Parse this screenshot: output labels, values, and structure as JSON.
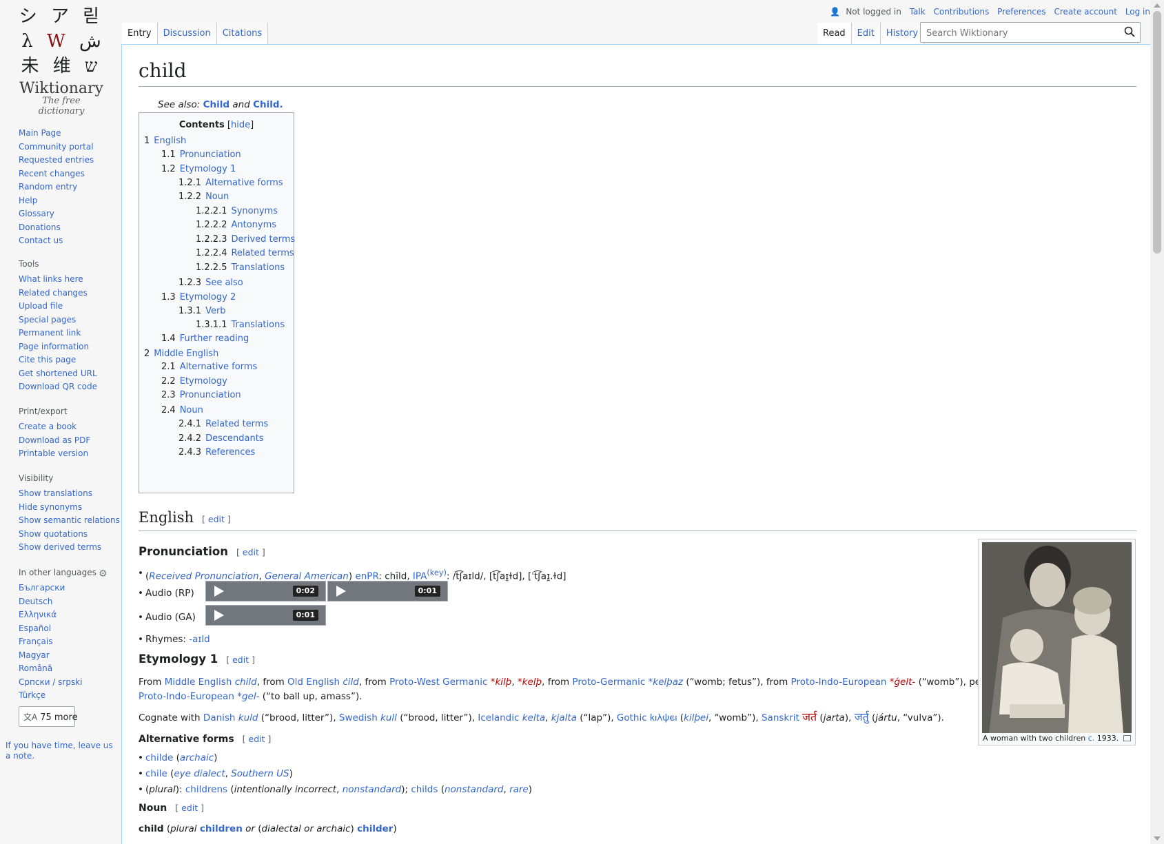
{
  "logo": {
    "glyph_row1": "シ ア 릳",
    "glyph_row2a": "λ ",
    "glyph_row2w": "W",
    "glyph_row2b": " ش",
    "glyph_row3": "未 维 ש",
    "name": "Wiktionary",
    "tagline": "The free dictionary"
  },
  "nav": {
    "main": [
      "Main Page",
      "Community portal",
      "Requested entries",
      "Recent changes",
      "Random entry",
      "Help",
      "Glossary",
      "Donations",
      "Contact us"
    ],
    "tools_title": "Tools",
    "tools": [
      "What links here",
      "Related changes",
      "Upload file",
      "Special pages",
      "Permanent link",
      "Page information",
      "Cite this page",
      "Get shortened URL",
      "Download QR code"
    ],
    "print_title": "Print/export",
    "print": [
      "Create a book",
      "Download as PDF",
      "Printable version"
    ],
    "visibility_title": "Visibility",
    "visibility": [
      "Show translations",
      "Hide synonyms",
      "Show semantic relations",
      "Show quotations",
      "Show derived terms"
    ],
    "languages_title": "In other languages",
    "languages": [
      "Български",
      "Deutsch",
      "Ελληνικά",
      "Español",
      "Français",
      "Magyar",
      "Română",
      "Српски / srpski",
      "Türkçe"
    ],
    "more_languages": "75 more",
    "time_note": "If you have time, leave us a note."
  },
  "personal": {
    "not_logged_in": "Not logged in",
    "talk": "Talk",
    "contributions": "Contributions",
    "preferences": "Preferences",
    "create_account": "Create account",
    "log_in": "Log in"
  },
  "tabs": {
    "entry": "Entry",
    "discussion": "Discussion",
    "citations": "Citations",
    "read": "Read",
    "edit": "Edit",
    "history": "History"
  },
  "search": {
    "placeholder": "Search Wiktionary"
  },
  "page": {
    "title": "child",
    "see_also_prefix": "See also:",
    "see_also_1": "Child",
    "see_also_and": "and",
    "see_also_2": "Child."
  },
  "toc": {
    "title": "Contents",
    "hide": "hide",
    "items": [
      {
        "num": "1",
        "label": "English"
      },
      {
        "num": "1.1",
        "label": "Pronunciation"
      },
      {
        "num": "1.2",
        "label": "Etymology 1"
      },
      {
        "num": "1.2.1",
        "label": "Alternative forms"
      },
      {
        "num": "1.2.2",
        "label": "Noun"
      },
      {
        "num": "1.2.2.1",
        "label": "Synonyms"
      },
      {
        "num": "1.2.2.2",
        "label": "Antonyms"
      },
      {
        "num": "1.2.2.3",
        "label": "Derived terms"
      },
      {
        "num": "1.2.2.4",
        "label": "Related terms"
      },
      {
        "num": "1.2.2.5",
        "label": "Translations"
      },
      {
        "num": "1.2.3",
        "label": "See also"
      },
      {
        "num": "1.3",
        "label": "Etymology 2"
      },
      {
        "num": "1.3.1",
        "label": "Verb"
      },
      {
        "num": "1.3.1.1",
        "label": "Translations"
      },
      {
        "num": "1.4",
        "label": "Further reading"
      },
      {
        "num": "2",
        "label": "Middle English"
      },
      {
        "num": "2.1",
        "label": "Alternative forms"
      },
      {
        "num": "2.2",
        "label": "Etymology"
      },
      {
        "num": "2.3",
        "label": "Pronunciation"
      },
      {
        "num": "2.4",
        "label": "Noun"
      },
      {
        "num": "2.4.1",
        "label": "Related terms"
      },
      {
        "num": "2.4.2",
        "label": "Descendants"
      },
      {
        "num": "2.4.3",
        "label": "References"
      }
    ]
  },
  "sections": {
    "edit": "edit",
    "english": "English",
    "pronunciation": "Pronunciation",
    "etymology1": "Etymology 1",
    "altforms": "Alternative forms",
    "noun": "Noun"
  },
  "pron": {
    "rp": "Received Pronunciation",
    "ga": "General American",
    "enpr": "enPR",
    "enpr_val": "chīld",
    "ipa": "IPA",
    "key": "(key)",
    "ipa_val": "/t͡ʃaɪld/, [t͡ʃaɪ̯ɫd], [ˈt͡ʃaɪ̯.ɫd]",
    "audio_rp": "Audio (RP)",
    "audio_ga": "Audio (GA)",
    "t1": "0:02",
    "t2": "0:01",
    "t3": "0:01",
    "rhymes": "Rhymes:",
    "rhymes_val": "-aɪld"
  },
  "etym": {
    "from": "From",
    "me": "Middle English",
    "me_word": "child",
    "from2": ", from",
    "oe": "Old English",
    "oe_word": "ċild",
    "from3": ", from",
    "pwg": "Proto-West Germanic",
    "pwg_w1": "*kilþ",
    "pwg_w2": "*kelþ",
    "from4": ", from",
    "pg": "Proto-Germanic",
    "pg_word": "*kelþaz",
    "pg_gloss": "(“womb; fetus”), from",
    "pie": "Proto-Indo-European",
    "pie_word": "*ǵelt-",
    "pie_gloss": "(“womb”), perhaps from",
    "pie2": "Proto-Indo-European",
    "pie2_word": "*gel-",
    "pie2_gloss": "(“to ball up, amass”).",
    "cog": "Cognate with",
    "danish": "Danish",
    "danish_w": "kuld",
    "danish_g": "(“brood, litter”),",
    "swedish": "Swedish",
    "swedish_w": "kull",
    "swedish_g": "(“brood, litter”),",
    "icelandic": "Icelandic",
    "ice_w1": "kelta",
    "ice_w2": "kjalta",
    "ice_g": "(“lap”),",
    "gothic": "Gothic",
    "gothic_w": "𐌺𐌹𐌻𐌸𐌴𐌹",
    "gothic_t": "kilþei",
    "gothic_g": "“womb”),",
    "sanskrit": "Sanskrit",
    "skt_w1": "जर्त",
    "skt_t1": "jarta",
    "skt_w2": "जर्तु",
    "skt_t2": "jártu",
    "skt_g": "“vulva”)."
  },
  "alt": {
    "a1": "childe",
    "a1n": "archaic",
    "a2": "chile",
    "a2n1": "eye dialect",
    "a2n2": "Southern US",
    "plural": "plural",
    "a3": "childrens",
    "a3n1": "intentionally incorrect",
    "a3n2": "nonstandard",
    "a4": "childs",
    "a4n1": "nonstandard",
    "a4n2": "rare"
  },
  "noun": {
    "headword": "child",
    "plural_label": "plural",
    "plural": "children",
    "or": "or",
    "dialectal": "dialectal or archaic",
    "alt_plural": "childer"
  },
  "thumb": {
    "caption_a": "A woman with two children",
    "caption_c": "c.",
    "caption_b": "1933."
  }
}
